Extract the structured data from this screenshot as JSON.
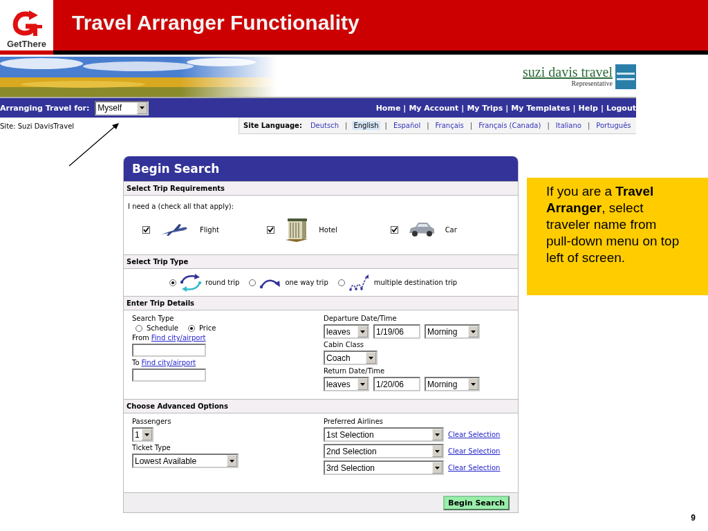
{
  "slide": {
    "logo_text": "GetThere",
    "title": "Travel Arranger Functionality",
    "page_number": "9"
  },
  "site": {
    "brand": "suzi davis travel",
    "brand_subtitle": "Representative",
    "arranging_label": "Arranging Travel for:",
    "traveler": "Myself",
    "separator": "|",
    "nav": [
      "Home",
      "My Account",
      "My Trips",
      "My Templates",
      "Help",
      "Logout"
    ],
    "site_name": "Site: Suzi DavisTravel",
    "language_label": "Site Language:",
    "languages": [
      {
        "label": "Deutsch",
        "selected": false
      },
      {
        "label": "English",
        "selected": true
      },
      {
        "label": "Español",
        "selected": false
      },
      {
        "label": "Français",
        "selected": false
      },
      {
        "label": "Français (Canada)",
        "selected": false
      },
      {
        "label": "Italiano",
        "selected": false
      },
      {
        "label": "Português",
        "selected": false
      }
    ]
  },
  "search": {
    "title": "Begin Search",
    "requirements": {
      "header": "Select Trip Requirements",
      "prompt": "I need a (check all that apply):",
      "options": [
        {
          "label": "Flight",
          "kind": "flight",
          "checked": true
        },
        {
          "label": "Hotel",
          "kind": "hotel",
          "checked": true
        },
        {
          "label": "Car",
          "kind": "car",
          "checked": true
        }
      ]
    },
    "trip_type": {
      "header": "Select Trip Type",
      "types": [
        {
          "label": "round trip",
          "kind": "round",
          "selected": true
        },
        {
          "label": "one way trip",
          "kind": "oneway",
          "selected": false
        },
        {
          "label": "multiple destination trip",
          "kind": "multi",
          "selected": false
        }
      ]
    },
    "details": {
      "header": "Enter Trip Details",
      "search_type_label": "Search Type",
      "search_types": [
        {
          "label": "Schedule",
          "selected": false
        },
        {
          "label": "Price",
          "selected": true
        }
      ],
      "from_label": "From",
      "from_link": "Find city/airport",
      "to_label": "To",
      "to_link": "Find city/airport",
      "departure_label": "Departure Date/Time",
      "departure": {
        "mode": "leaves",
        "date": "1/19/06",
        "time": "Morning"
      },
      "cabin_label": "Cabin Class",
      "cabin": "Coach",
      "return_label": "Return Date/Time",
      "return": {
        "mode": "leaves",
        "date": "1/20/06",
        "time": "Morning"
      }
    },
    "advanced": {
      "header": "Choose Advanced Options",
      "passengers_label": "Passengers",
      "passengers": "1",
      "ticket_label": "Ticket Type",
      "ticket": "Lowest Available",
      "airlines_label": "Preferred Airlines",
      "airlines": [
        {
          "selection": "1st Selection",
          "clear": "Clear Selection"
        },
        {
          "selection": "2nd Selection",
          "clear": "Clear Selection"
        },
        {
          "selection": "3rd Selection",
          "clear": "Clear Selection"
        }
      ]
    },
    "button": "Begin Search"
  },
  "callout": "If you are a **Travel Arranger**, select traveler name from pull-down menu on top left of screen."
}
